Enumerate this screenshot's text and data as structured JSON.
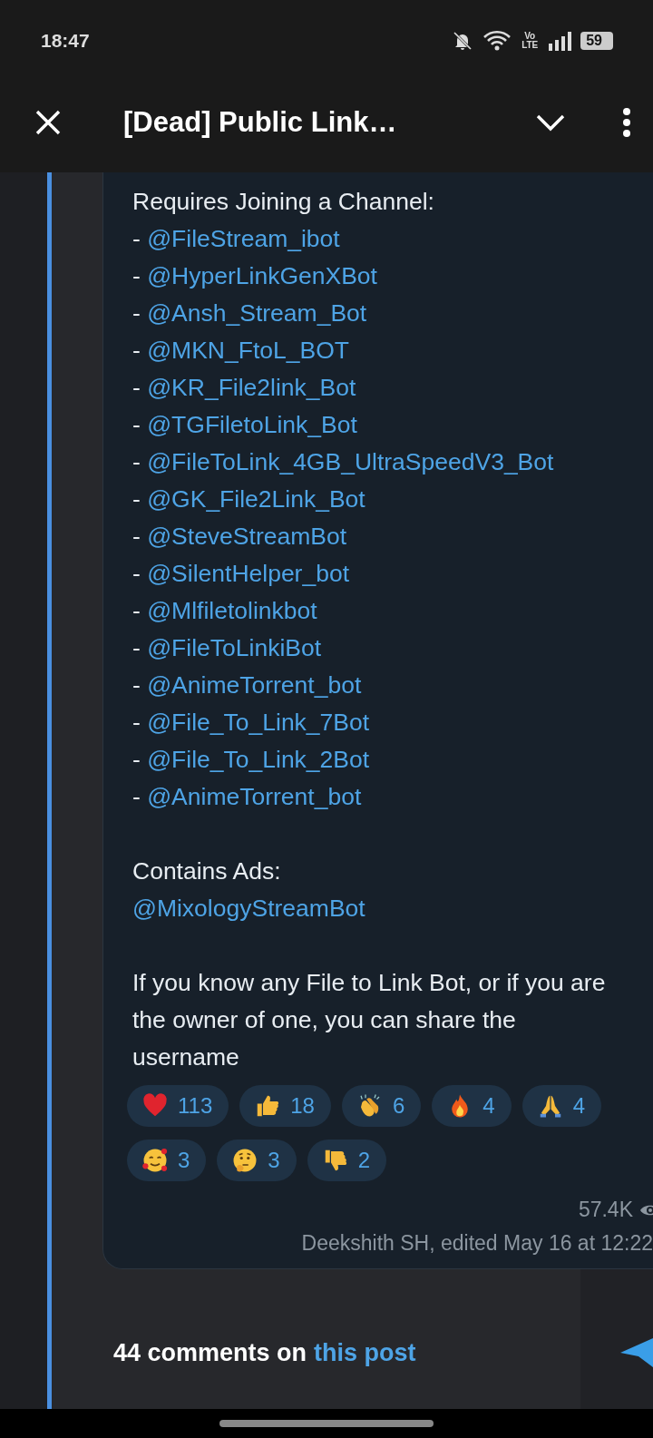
{
  "status_bar": {
    "time": "18:47",
    "battery": "59",
    "network_label": "Vo LTE"
  },
  "header": {
    "title": "[Dead] Public Link…"
  },
  "message": {
    "intro": "Requires Joining a Channel:",
    "bots": [
      {
        "prefix": "- ",
        "link": "@FileStream_ibot"
      },
      {
        "prefix": "- ",
        "link": "@HyperLinkGenXBot"
      },
      {
        "prefix": "- ",
        "link": "@Ansh_Stream_Bot"
      },
      {
        "prefix": "- ",
        "link": "@MKN_FtoL_BOT"
      },
      {
        "prefix": "- ",
        "link": "@KR_File2link_Bot"
      },
      {
        "prefix": "- ",
        "link": "@TGFiletoLink_Bot"
      },
      {
        "prefix": "- ",
        "link": "@FileToLink_4GB_UltraSpeedV3_Bot"
      },
      {
        "prefix": "- ",
        "link": "@GK_File2Link_Bot"
      },
      {
        "prefix": "- ",
        "link": "@SteveStreamBot"
      },
      {
        "prefix": "- ",
        "link": "@SilentHelper_bot"
      },
      {
        "prefix": "- ",
        "link": "@Mlfiletolinkbot"
      },
      {
        "prefix": "- ",
        "link": "@FileToLinkiBot"
      },
      {
        "prefix": "- ",
        "link": "@AnimeTorrent_bot"
      },
      {
        "prefix": "- ",
        "link": "@File_To_Link_7Bot"
      },
      {
        "prefix": "- ",
        "link": "@File_To_Link_2Bot"
      },
      {
        "prefix": "- ",
        "link": "@AnimeTorrent_bot"
      }
    ],
    "ads_label": "Contains Ads:",
    "ads_link": "@MixologyStreamBot",
    "outro": "If you know any File to Link Bot, or if you are the owner of one, you can share the username",
    "reactions": [
      {
        "kind": "heart",
        "count": "113"
      },
      {
        "kind": "thumbs-up",
        "count": "18"
      },
      {
        "kind": "clap",
        "count": "6"
      },
      {
        "kind": "fire",
        "count": "4"
      },
      {
        "kind": "pray",
        "count": "4"
      },
      {
        "kind": "hearts-face",
        "count": "3"
      },
      {
        "kind": "thinking",
        "count": "3"
      },
      {
        "kind": "thumbs-down",
        "count": "2"
      }
    ],
    "views": "57.4K",
    "signature": "Deekshith SH, edited  May 16 at 12:22"
  },
  "comments": {
    "text": "44 comments on",
    "link": "this post"
  }
}
